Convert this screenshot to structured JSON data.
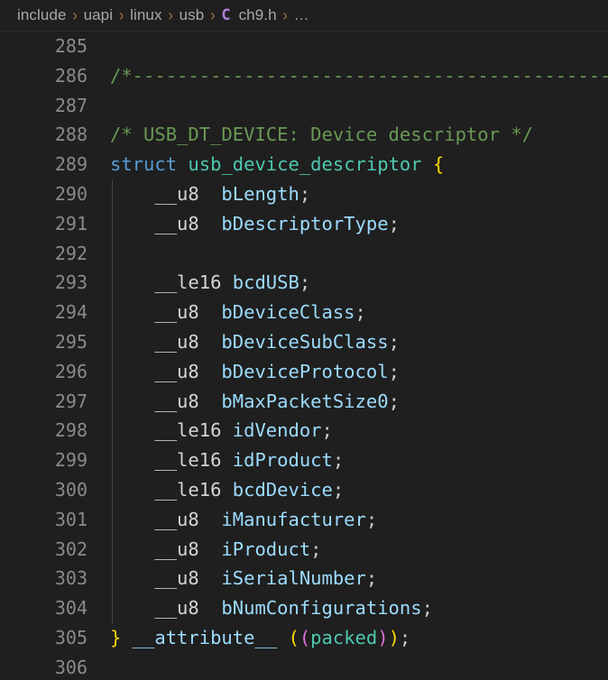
{
  "window": {
    "background": "#1f1f1f",
    "editor_background": "#1f1f1f"
  },
  "breadcrumb": {
    "separator": "›",
    "ellipsis": "…",
    "file_icon_glyph": "C",
    "file_icon_color": "#b180d7",
    "separator_color": "#a07a4a",
    "text_color": "#a9a9a9",
    "items": [
      {
        "label": "include",
        "kind": "folder"
      },
      {
        "label": "uapi",
        "kind": "folder"
      },
      {
        "label": "linux",
        "kind": "folder"
      },
      {
        "label": "usb",
        "kind": "folder"
      },
      {
        "label": "ch9.h",
        "kind": "file"
      },
      {
        "label": "…",
        "kind": "symbol"
      }
    ]
  },
  "editor": {
    "language": "c",
    "file_name": "ch9.h",
    "first_visible_line": 285,
    "last_visible_line": 306,
    "line_number_color": "#8a8a8a",
    "indent_guide_color": "#474747",
    "colors": {
      "comment": "#6a9955",
      "keyword": "#569cd6",
      "type": "#4ec9b0",
      "variable": "#9cdcfe",
      "plain": "#d4d4d4",
      "punctuation": "#cccccc",
      "bracket_level_1": "#ffd700",
      "bracket_level_2": "#da70d6",
      "bracket_level_3": "#179fff"
    },
    "lines": [
      {
        "n": 285,
        "tokens": []
      },
      {
        "n": 286,
        "tokens": [
          {
            "t": "/*------------------------------------------------------------",
            "c": "t-comment"
          }
        ]
      },
      {
        "n": 287,
        "tokens": []
      },
      {
        "n": 288,
        "tokens": [
          {
            "t": "/* USB_DT_DEVICE: Device descriptor */",
            "c": "t-comment"
          }
        ]
      },
      {
        "n": 289,
        "tokens": [
          {
            "t": "struct",
            "c": "t-keyword"
          },
          {
            "t": " ",
            "c": "t-plain"
          },
          {
            "t": "usb_device_descriptor",
            "c": "t-type"
          },
          {
            "t": " ",
            "c": "t-plain"
          },
          {
            "t": "{",
            "c": "t-br1"
          }
        ]
      },
      {
        "n": 290,
        "tokens": [
          {
            "t": "    __u8  ",
            "c": "t-plain"
          },
          {
            "t": "bLength",
            "c": "t-var"
          },
          {
            "t": ";",
            "c": "t-punc"
          }
        ]
      },
      {
        "n": 291,
        "tokens": [
          {
            "t": "    __u8  ",
            "c": "t-plain"
          },
          {
            "t": "bDescriptorType",
            "c": "t-var"
          },
          {
            "t": ";",
            "c": "t-punc"
          }
        ]
      },
      {
        "n": 292,
        "tokens": []
      },
      {
        "n": 293,
        "tokens": [
          {
            "t": "    __le16 ",
            "c": "t-plain"
          },
          {
            "t": "bcdUSB",
            "c": "t-var"
          },
          {
            "t": ";",
            "c": "t-punc"
          }
        ]
      },
      {
        "n": 294,
        "tokens": [
          {
            "t": "    __u8  ",
            "c": "t-plain"
          },
          {
            "t": "bDeviceClass",
            "c": "t-var"
          },
          {
            "t": ";",
            "c": "t-punc"
          }
        ]
      },
      {
        "n": 295,
        "tokens": [
          {
            "t": "    __u8  ",
            "c": "t-plain"
          },
          {
            "t": "bDeviceSubClass",
            "c": "t-var"
          },
          {
            "t": ";",
            "c": "t-punc"
          }
        ]
      },
      {
        "n": 296,
        "tokens": [
          {
            "t": "    __u8  ",
            "c": "t-plain"
          },
          {
            "t": "bDeviceProtocol",
            "c": "t-var"
          },
          {
            "t": ";",
            "c": "t-punc"
          }
        ]
      },
      {
        "n": 297,
        "tokens": [
          {
            "t": "    __u8  ",
            "c": "t-plain"
          },
          {
            "t": "bMaxPacketSize0",
            "c": "t-var"
          },
          {
            "t": ";",
            "c": "t-punc"
          }
        ]
      },
      {
        "n": 298,
        "tokens": [
          {
            "t": "    __le16 ",
            "c": "t-plain"
          },
          {
            "t": "idVendor",
            "c": "t-var"
          },
          {
            "t": ";",
            "c": "t-punc"
          }
        ]
      },
      {
        "n": 299,
        "tokens": [
          {
            "t": "    __le16 ",
            "c": "t-plain"
          },
          {
            "t": "idProduct",
            "c": "t-var"
          },
          {
            "t": ";",
            "c": "t-punc"
          }
        ]
      },
      {
        "n": 300,
        "tokens": [
          {
            "t": "    __le16 ",
            "c": "t-plain"
          },
          {
            "t": "bcdDevice",
            "c": "t-var"
          },
          {
            "t": ";",
            "c": "t-punc"
          }
        ]
      },
      {
        "n": 301,
        "tokens": [
          {
            "t": "    __u8  ",
            "c": "t-plain"
          },
          {
            "t": "iManufacturer",
            "c": "t-var"
          },
          {
            "t": ";",
            "c": "t-punc"
          }
        ]
      },
      {
        "n": 302,
        "tokens": [
          {
            "t": "    __u8  ",
            "c": "t-plain"
          },
          {
            "t": "iProduct",
            "c": "t-var"
          },
          {
            "t": ";",
            "c": "t-punc"
          }
        ]
      },
      {
        "n": 303,
        "tokens": [
          {
            "t": "    __u8  ",
            "c": "t-plain"
          },
          {
            "t": "iSerialNumber",
            "c": "t-var"
          },
          {
            "t": ";",
            "c": "t-punc"
          }
        ]
      },
      {
        "n": 304,
        "tokens": [
          {
            "t": "    __u8  ",
            "c": "t-plain"
          },
          {
            "t": "bNumConfigurations",
            "c": "t-var"
          },
          {
            "t": ";",
            "c": "t-punc"
          }
        ]
      },
      {
        "n": 305,
        "tokens": [
          {
            "t": "}",
            "c": "t-br1"
          },
          {
            "t": " ",
            "c": "t-plain"
          },
          {
            "t": "__attribute__",
            "c": "t-var"
          },
          {
            "t": " ",
            "c": "t-plain"
          },
          {
            "t": "(",
            "c": "t-br1"
          },
          {
            "t": "(",
            "c": "t-br2"
          },
          {
            "t": "packed",
            "c": "t-type"
          },
          {
            "t": ")",
            "c": "t-br2"
          },
          {
            "t": ")",
            "c": "t-br1"
          },
          {
            "t": ";",
            "c": "t-punc"
          }
        ]
      },
      {
        "n": 306,
        "tokens": []
      }
    ]
  }
}
